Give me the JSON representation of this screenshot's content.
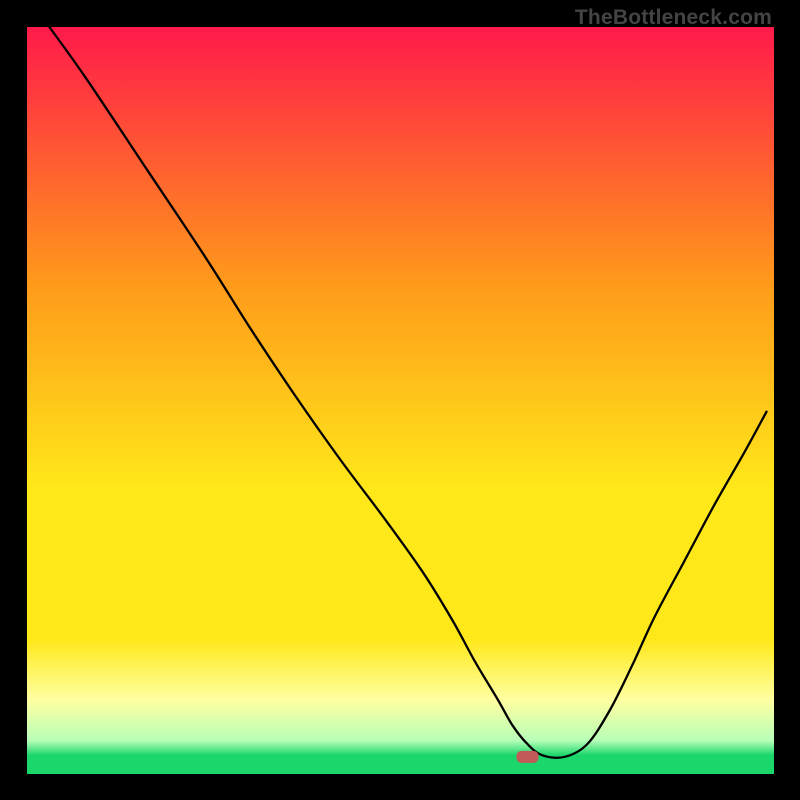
{
  "watermark": "TheBottleneck.com",
  "colors": {
    "frame": "#000000",
    "top_red": "#ff1a4a",
    "mid_orange": "#ff9c1a",
    "yellow": "#ffe81a",
    "pale_yellow": "#ffffa0",
    "pale_green": "#b8ffb8",
    "green": "#1ad66b",
    "curve": "#000000",
    "marker": "#c35a5a"
  },
  "chart_data": {
    "type": "line",
    "title": "",
    "xlabel": "",
    "ylabel": "",
    "xlim": [
      0,
      100
    ],
    "ylim": [
      0,
      100
    ],
    "curve_x": [
      3,
      8,
      16,
      24,
      30,
      36,
      42,
      48,
      53,
      57,
      60,
      63,
      65,
      67,
      69,
      72,
      75,
      78,
      81,
      84,
      88,
      92,
      96,
      99
    ],
    "curve_y": [
      100,
      93,
      81,
      69,
      59.5,
      50.5,
      42,
      34,
      27,
      20.5,
      15,
      10,
      6.5,
      4,
      2.5,
      2.3,
      4,
      8.5,
      14.5,
      21,
      28.5,
      36,
      43,
      48.5
    ],
    "marker": {
      "x": 67,
      "y": 2.3
    },
    "grid": false,
    "legend": false
  }
}
